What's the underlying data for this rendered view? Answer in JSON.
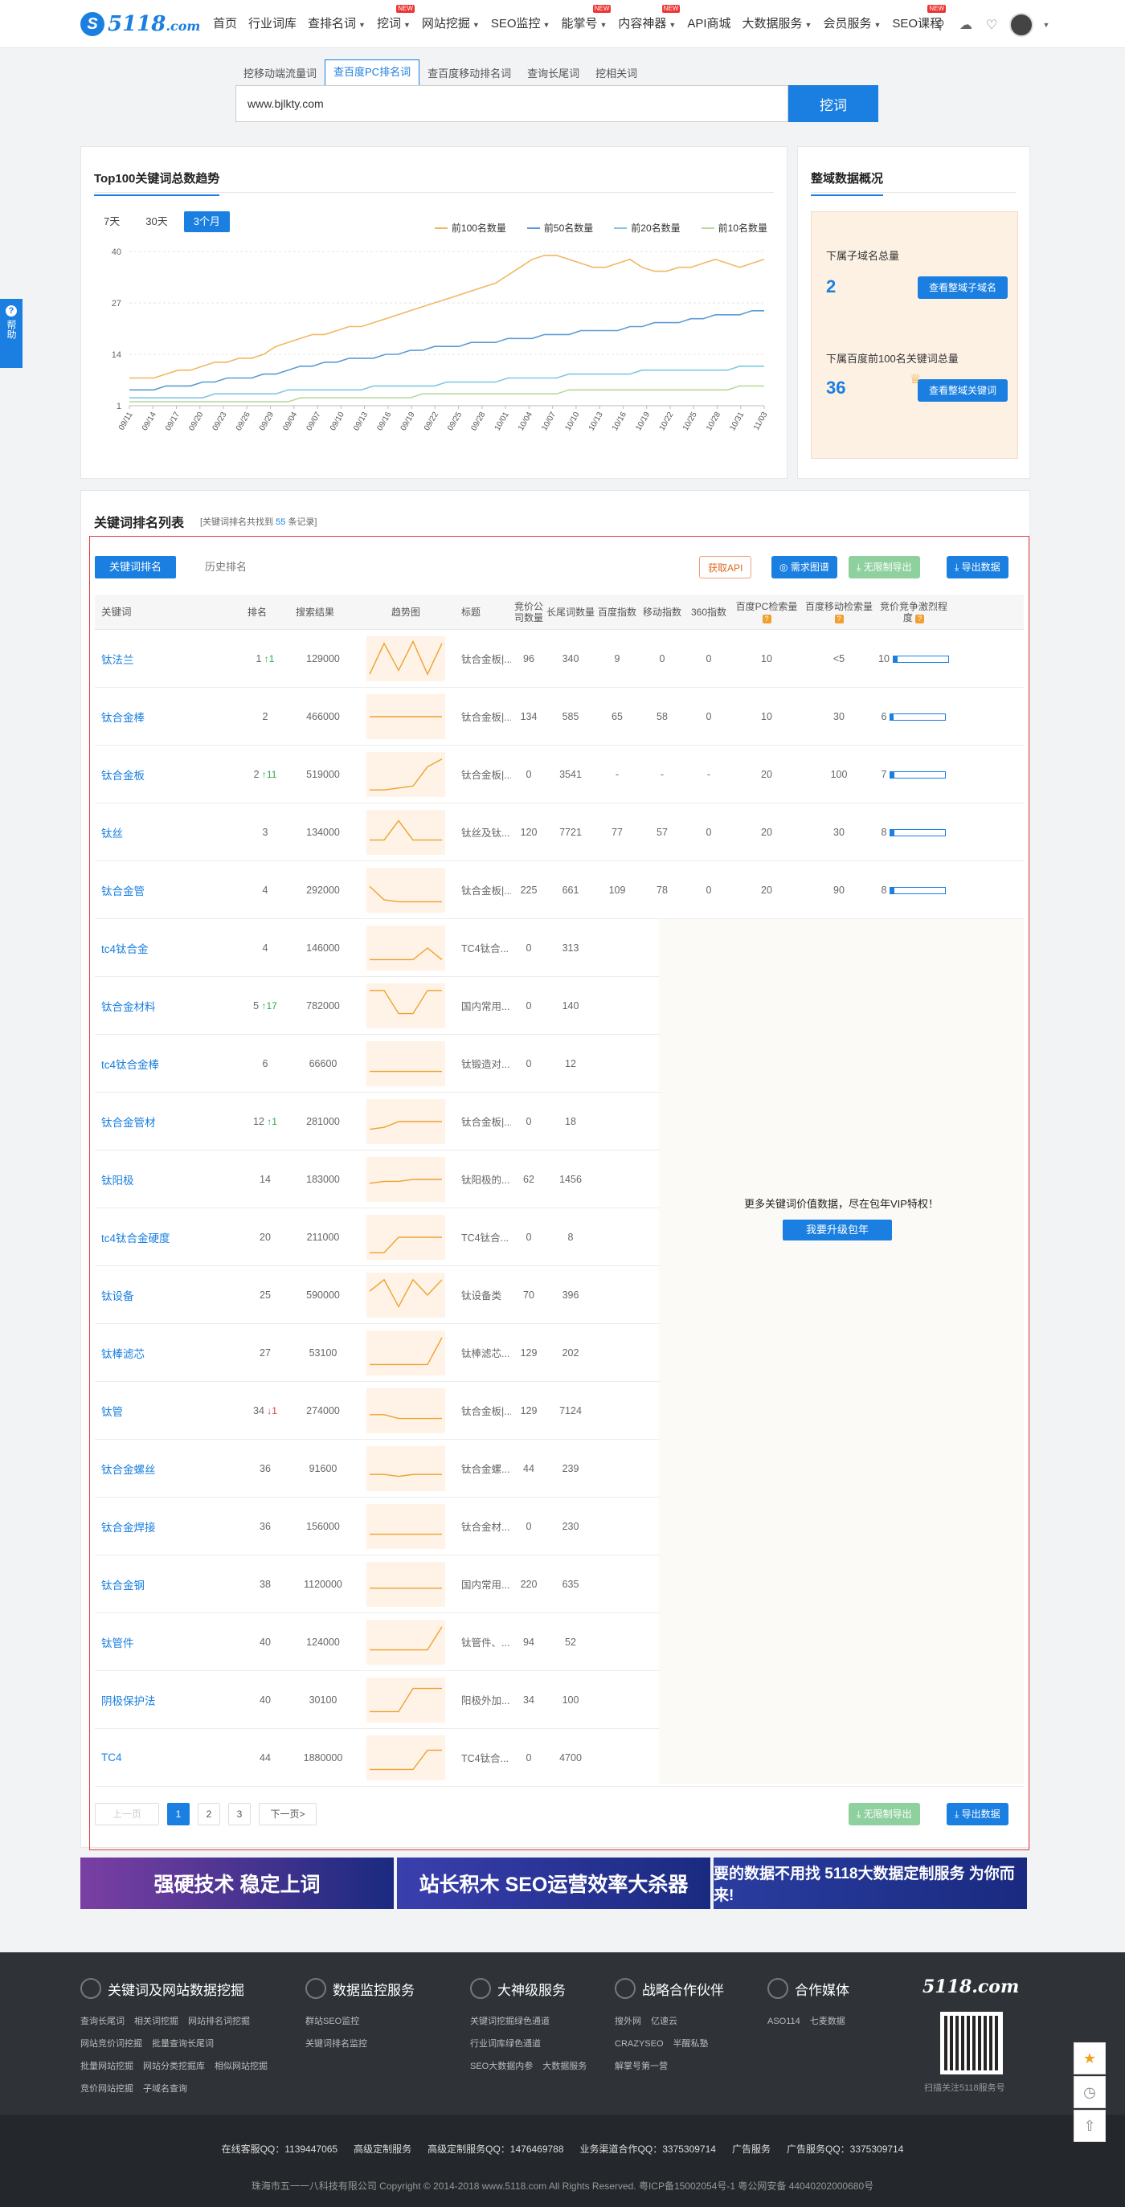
{
  "logo": {
    "mark": "S",
    "text": "5118",
    "suffix": ".com"
  },
  "nav": [
    {
      "label": "首页",
      "dropdown": false,
      "new": false
    },
    {
      "label": "行业词库",
      "dropdown": false,
      "new": false
    },
    {
      "label": "查排名词",
      "dropdown": true,
      "new": false
    },
    {
      "label": "挖词",
      "dropdown": true,
      "new": true
    },
    {
      "label": "网站挖掘",
      "dropdown": true,
      "new": false
    },
    {
      "label": "SEO监控",
      "dropdown": true,
      "new": false
    },
    {
      "label": "能掌号",
      "dropdown": true,
      "new": true
    },
    {
      "label": "内容神器",
      "dropdown": true,
      "new": true
    },
    {
      "label": "API商城",
      "dropdown": false,
      "new": false
    },
    {
      "label": "大数据服务",
      "dropdown": true,
      "new": false
    },
    {
      "label": "会员服务",
      "dropdown": true,
      "new": false
    },
    {
      "label": "SEO课程",
      "dropdown": false,
      "new": true
    }
  ],
  "new_badge": "NEW",
  "search": {
    "tabs": [
      "挖移动端流量词",
      "查百度PC排名词",
      "查百度移动排名词",
      "查询长尾词",
      "挖相关词"
    ],
    "active_tab": 1,
    "value": "www.bjlkty.com",
    "button": "挖词"
  },
  "trend": {
    "title": "Top100关键词总数趋势",
    "periods": [
      "7天",
      "30天",
      "3个月"
    ],
    "active_period": 2
  },
  "chart_data": {
    "type": "line",
    "title": "Top100关键词总数趋势",
    "y_ticks": [
      1,
      14,
      27,
      40
    ],
    "ylim": [
      1,
      40
    ],
    "x_ticks": [
      "09/11",
      "09/14",
      "09/17",
      "09/20",
      "09/23",
      "09/26",
      "09/29",
      "09/04",
      "09/07",
      "09/10",
      "09/13",
      "09/16",
      "09/19",
      "09/22",
      "09/25",
      "09/28",
      "10/01",
      "10/04",
      "10/07",
      "10/10",
      "10/13",
      "10/16",
      "10/19",
      "10/22",
      "10/25",
      "10/28",
      "10/31",
      "11/03"
    ],
    "legend_position": "top-right",
    "series": [
      {
        "name": "前100名数量",
        "color": "#f0b860",
        "values": [
          8,
          8,
          8,
          9,
          10,
          10,
          11,
          12,
          12,
          13,
          13,
          14,
          16,
          17,
          18,
          19,
          19,
          20,
          21,
          21,
          22,
          23,
          24,
          25,
          26,
          27,
          28,
          29,
          30,
          31,
          32,
          34,
          36,
          38,
          39,
          39,
          38,
          37,
          36,
          36,
          37,
          38,
          36,
          35,
          35,
          36,
          36,
          37,
          38,
          37,
          36,
          37,
          38
        ]
      },
      {
        "name": "前50名数量",
        "color": "#5b9bd5",
        "values": [
          5,
          5,
          5,
          6,
          6,
          6,
          7,
          7,
          8,
          8,
          8,
          9,
          9,
          10,
          11,
          11,
          12,
          12,
          13,
          13,
          13,
          14,
          14,
          15,
          15,
          16,
          16,
          16,
          17,
          17,
          17,
          18,
          18,
          18,
          19,
          19,
          19,
          20,
          20,
          20,
          20,
          21,
          21,
          22,
          22,
          22,
          23,
          23,
          24,
          24,
          24,
          25,
          25
        ]
      },
      {
        "name": "前20名数量",
        "color": "#7fc8e0",
        "values": [
          3,
          3,
          3,
          3,
          3,
          3,
          3,
          4,
          4,
          4,
          4,
          4,
          4,
          5,
          5,
          5,
          5,
          5,
          5,
          5,
          6,
          6,
          6,
          6,
          6,
          6,
          7,
          7,
          7,
          7,
          7,
          8,
          8,
          8,
          8,
          8,
          9,
          9,
          9,
          9,
          9,
          9,
          10,
          10,
          10,
          10,
          10,
          10,
          10,
          10,
          11,
          11,
          11
        ]
      },
      {
        "name": "前10名数量",
        "color": "#b9d99a",
        "values": [
          2,
          2,
          2,
          2,
          2,
          2,
          2,
          2,
          2,
          2,
          2,
          2,
          2,
          2,
          3,
          3,
          3,
          3,
          3,
          3,
          3,
          3,
          3,
          3,
          4,
          4,
          4,
          4,
          4,
          4,
          4,
          4,
          4,
          4,
          4,
          4,
          5,
          5,
          5,
          5,
          5,
          5,
          5,
          5,
          5,
          5,
          5,
          5,
          5,
          5,
          6,
          6,
          6
        ]
      }
    ]
  },
  "overview": {
    "title": "整域数据概况",
    "subdomain_label": "下属子域名总量",
    "subdomain_count": "2",
    "subdomain_btn": "查看整域子域名",
    "top100_label": "下属百度前100名关键词总量",
    "top100_count": "36",
    "top100_btn": "查看整域关键词"
  },
  "kw": {
    "title": "关键词排名列表",
    "sub_prefix": "[关键词排名共找到",
    "sub_count": "55",
    "sub_suffix": "条记录]",
    "tabs": [
      "关键词排名",
      "历史排名"
    ],
    "active_tab": 0,
    "btn_api": "获取API",
    "btn_req": "需求图谱",
    "btn_unlimited": "无限制导出",
    "btn_export": "导出数据",
    "headers": [
      "关键词",
      "排名",
      "搜索结果",
      "趋势图",
      "标题",
      "竞价公司数量",
      "长尾词数量",
      "百度指数",
      "移动指数",
      "360指数",
      "百度PC检索量",
      "百度移动检索量",
      "竞价竞争激烈程度"
    ],
    "rows": [
      {
        "kw": "钛法兰",
        "rank": "1",
        "change": "1",
        "dir": "up",
        "results": "129000",
        "title": "钛合金板|...",
        "bid": "96",
        "long": "340",
        "bd": "9",
        "mob": "0",
        "s360": "0",
        "pc": "10",
        "mv": "<5",
        "comp": "10",
        "comp_pct": 0.08,
        "spark": [
          0.1,
          0.9,
          0.2,
          0.95,
          0.1,
          0.9
        ]
      },
      {
        "kw": "钛合金棒",
        "rank": "2",
        "change": "",
        "dir": "",
        "results": "466000",
        "title": "钛合金板|...",
        "bid": "134",
        "long": "585",
        "bd": "65",
        "mob": "58",
        "s360": "0",
        "pc": "10",
        "mv": "30",
        "comp": "6",
        "comp_pct": 0.05,
        "spark": [
          0.5,
          0.5,
          0.5,
          0.5,
          0.5,
          0.5
        ]
      },
      {
        "kw": "钛合金板",
        "rank": "2",
        "change": "11",
        "dir": "up",
        "results": "519000",
        "title": "钛合金板|...",
        "bid": "0",
        "long": "3541",
        "bd": "-",
        "mob": "-",
        "s360": "-",
        "pc": "20",
        "mv": "100",
        "comp": "7",
        "comp_pct": 0.06,
        "spark": [
          0.1,
          0.1,
          0.15,
          0.2,
          0.7,
          0.9
        ]
      },
      {
        "kw": "钛丝",
        "rank": "3",
        "change": "",
        "dir": "",
        "results": "134000",
        "title": "钛丝及钛...",
        "bid": "120",
        "long": "7721",
        "bd": "77",
        "mob": "57",
        "s360": "0",
        "pc": "20",
        "mv": "30",
        "comp": "8",
        "comp_pct": 0.07,
        "spark": [
          0.3,
          0.3,
          0.8,
          0.3,
          0.3,
          0.3
        ]
      },
      {
        "kw": "钛合金管",
        "rank": "4",
        "change": "",
        "dir": "",
        "results": "292000",
        "title": "钛合金板|...",
        "bid": "225",
        "long": "661",
        "bd": "109",
        "mob": "78",
        "s360": "0",
        "pc": "20",
        "mv": "90",
        "comp": "8",
        "comp_pct": 0.07,
        "spark": [
          0.6,
          0.25,
          0.2,
          0.2,
          0.2,
          0.2
        ]
      },
      {
        "kw": "tc4钛合金",
        "rank": "4",
        "change": "",
        "dir": "",
        "results": "146000",
        "title": "TC4钛合...",
        "bid": "0",
        "long": "313",
        "spark": [
          0.2,
          0.2,
          0.2,
          0.2,
          0.5,
          0.2
        ]
      },
      {
        "kw": "钛合金材料",
        "rank": "5",
        "change": "17",
        "dir": "up",
        "results": "782000",
        "title": "国内常用...",
        "bid": "0",
        "long": "140",
        "spark": [
          0.9,
          0.9,
          0.3,
          0.3,
          0.9,
          0.9
        ]
      },
      {
        "kw": "tc4钛合金棒",
        "rank": "6",
        "change": "",
        "dir": "",
        "results": "66600",
        "title": "钛锻造对...",
        "bid": "0",
        "long": "12",
        "spark": [
          0.3,
          0.3,
          0.3,
          0.3,
          0.3,
          0.3
        ]
      },
      {
        "kw": "钛合金管材",
        "rank": "12",
        "change": "1",
        "dir": "up",
        "results": "281000",
        "title": "钛合金板|...",
        "bid": "0",
        "long": "18",
        "spark": [
          0.3,
          0.35,
          0.5,
          0.5,
          0.5,
          0.5
        ]
      },
      {
        "kw": "钛阳极",
        "rank": "14",
        "change": "",
        "dir": "",
        "results": "183000",
        "title": "钛阳极的...",
        "bid": "62",
        "long": "1456",
        "spark": [
          0.4,
          0.45,
          0.45,
          0.5,
          0.5,
          0.5
        ]
      },
      {
        "kw": "tc4钛合金硬度",
        "rank": "20",
        "change": "",
        "dir": "",
        "results": "211000",
        "title": "TC4钛合...",
        "bid": "0",
        "long": "8",
        "spark": [
          0.1,
          0.1,
          0.5,
          0.5,
          0.5,
          0.5
        ]
      },
      {
        "kw": "钛设备",
        "rank": "25",
        "change": "",
        "dir": "",
        "results": "590000",
        "title": "钛设备类",
        "bid": "70",
        "long": "396",
        "spark": [
          0.6,
          0.9,
          0.2,
          0.9,
          0.5,
          0.9
        ]
      },
      {
        "kw": "钛棒滤芯",
        "rank": "27",
        "change": "",
        "dir": "",
        "results": "53100",
        "title": "钛棒滤芯...",
        "bid": "129",
        "long": "202",
        "spark": [
          0.2,
          0.2,
          0.2,
          0.2,
          0.2,
          0.9
        ]
      },
      {
        "kw": "钛管",
        "rank": "34",
        "change": "1",
        "dir": "down",
        "results": "274000",
        "title": "钛合金板|...",
        "bid": "129",
        "long": "7124",
        "spark": [
          0.4,
          0.4,
          0.3,
          0.3,
          0.3,
          0.3
        ]
      },
      {
        "kw": "钛合金螺丝",
        "rank": "36",
        "change": "",
        "dir": "",
        "results": "91600",
        "title": "钛合金螺...",
        "bid": "44",
        "long": "239",
        "spark": [
          0.35,
          0.35,
          0.3,
          0.35,
          0.35,
          0.35
        ]
      },
      {
        "kw": "钛合金焊接",
        "rank": "36",
        "change": "",
        "dir": "",
        "results": "156000",
        "title": "钛合金材...",
        "bid": "0",
        "long": "230",
        "spark": [
          0.3,
          0.3,
          0.3,
          0.3,
          0.3,
          0.3
        ]
      },
      {
        "kw": "钛合金钢",
        "rank": "38",
        "change": "",
        "dir": "",
        "results": "1120000",
        "title": "国内常用...",
        "bid": "220",
        "long": "635",
        "spark": [
          0.4,
          0.4,
          0.4,
          0.4,
          0.4,
          0.4
        ]
      },
      {
        "kw": "钛管件",
        "rank": "40",
        "change": "",
        "dir": "",
        "results": "124000",
        "title": "钛管件、...",
        "bid": "94",
        "long": "52",
        "spark": [
          0.3,
          0.3,
          0.3,
          0.3,
          0.3,
          0.9
        ]
      },
      {
        "kw": "阴极保护法",
        "rank": "40",
        "change": "",
        "dir": "",
        "results": "30100",
        "title": "阳极外加...",
        "bid": "34",
        "long": "100",
        "spark": [
          0.2,
          0.2,
          0.2,
          0.8,
          0.8,
          0.8
        ]
      },
      {
        "kw": "TC4",
        "rank": "44",
        "change": "",
        "dir": "",
        "results": "1880000",
        "title": "TC4钛合...",
        "bid": "0",
        "long": "4700",
        "spark": [
          0.2,
          0.2,
          0.2,
          0.2,
          0.7,
          0.7
        ]
      }
    ],
    "vip_text": "更多关键词价值数据，尽在包年VIP特权！",
    "vip_btn": "我要升级包年",
    "pager": {
      "prev": "上一页",
      "pages": [
        "1",
        "2",
        "3"
      ],
      "active": 0,
      "next": "下一页>"
    }
  },
  "banners": [
    {
      "text": "强硬技术  稳定上词",
      "color": "#7b3fa3"
    },
    {
      "text": "站长积木  SEO运营效率大杀器",
      "color": "#3a3fae"
    },
    {
      "text": "要的数据不用找  5118大数据定制服务 为你而来!",
      "color": "#2a3da0"
    }
  ],
  "footer": {
    "cols": [
      {
        "head": "关键词及网站数据挖掘",
        "links": [
          [
            "查询长尾词",
            "相关词挖掘",
            "网站排名词挖掘"
          ],
          [
            "网站竞价词挖掘",
            "批量查询长尾词"
          ],
          [
            "批量网站挖掘",
            "网站分类挖掘库",
            "相似网站挖掘"
          ],
          [
            "竞价网站挖掘",
            "子域名查询"
          ]
        ]
      },
      {
        "head": "数据监控服务",
        "links": [
          [
            "群站SEO监控"
          ],
          [
            "关键词排名监控"
          ]
        ]
      },
      {
        "head": "大神级服务",
        "links": [
          [
            "关键词挖掘绿色通道"
          ],
          [
            "行业词库绿色通道"
          ],
          [
            "SEO大数据内参",
            "大数据服务"
          ]
        ]
      },
      {
        "head": "战略合作伙伴",
        "links": [
          [
            "搜外网",
            "亿速云"
          ],
          [
            "CRAZYSEO",
            "半醒私塾"
          ],
          [
            "解掌号第一营"
          ]
        ]
      },
      {
        "head": "合作媒体",
        "links": [
          [
            "ASO114",
            "七麦数据"
          ]
        ]
      }
    ],
    "logo": "5118.com",
    "qr_caption": "扫描关注5118服务号",
    "row1": [
      "在线客服QQ：1139447065",
      "高级定制服务",
      "高级定制服务QQ：1476469788",
      "业务渠道合作QQ：3375309714",
      "广告服务",
      "广告服务QQ：3375309714"
    ],
    "row2": "珠海市五一一八科技有限公司  Copyright © 2014-2018 www.5118.com All Rights Reserved.  粤ICP备15002054号-1  粤公网安备 44040202000680号"
  },
  "help": "帮助"
}
